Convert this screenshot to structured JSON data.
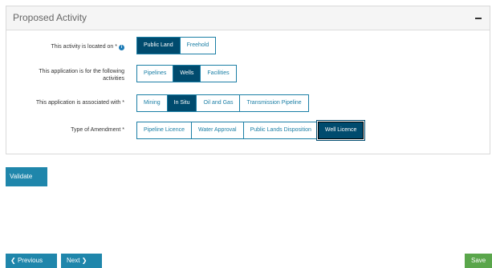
{
  "panel": {
    "title": "Proposed Activity"
  },
  "rows": [
    {
      "label": "This activity is located on *",
      "options": [
        {
          "label": "Public Land",
          "selected": true
        },
        {
          "label": "Freehold",
          "selected": false
        }
      ]
    },
    {
      "label_line1": "This application is for the following",
      "label_line2": "activities",
      "options": [
        {
          "label": "Pipelines",
          "selected": false
        },
        {
          "label": "Wells",
          "selected": true
        },
        {
          "label": "Facilities",
          "selected": false
        }
      ]
    },
    {
      "label": "This application is associated with *",
      "options": [
        {
          "label": "Mining",
          "selected": false
        },
        {
          "label": "In Situ",
          "selected": true
        },
        {
          "label": "Oil and Gas",
          "selected": false
        },
        {
          "label": "Transmission Pipeline",
          "selected": false
        }
      ]
    },
    {
      "label": "Type of Amendment *",
      "options": [
        {
          "label": "Pipeline Licence",
          "selected": false
        },
        {
          "label": "Water Approval",
          "selected": false
        },
        {
          "label": "Public Lands Disposition",
          "selected": false
        },
        {
          "label": "Well Licence",
          "selected": true
        }
      ]
    }
  ],
  "buttons": {
    "validate": "Validate",
    "previous": "Previous",
    "next": "Next",
    "save": "Save"
  },
  "colors": {
    "selected": "#004b6e",
    "accent": "#1a7ea5",
    "save": "#5aa64b"
  }
}
